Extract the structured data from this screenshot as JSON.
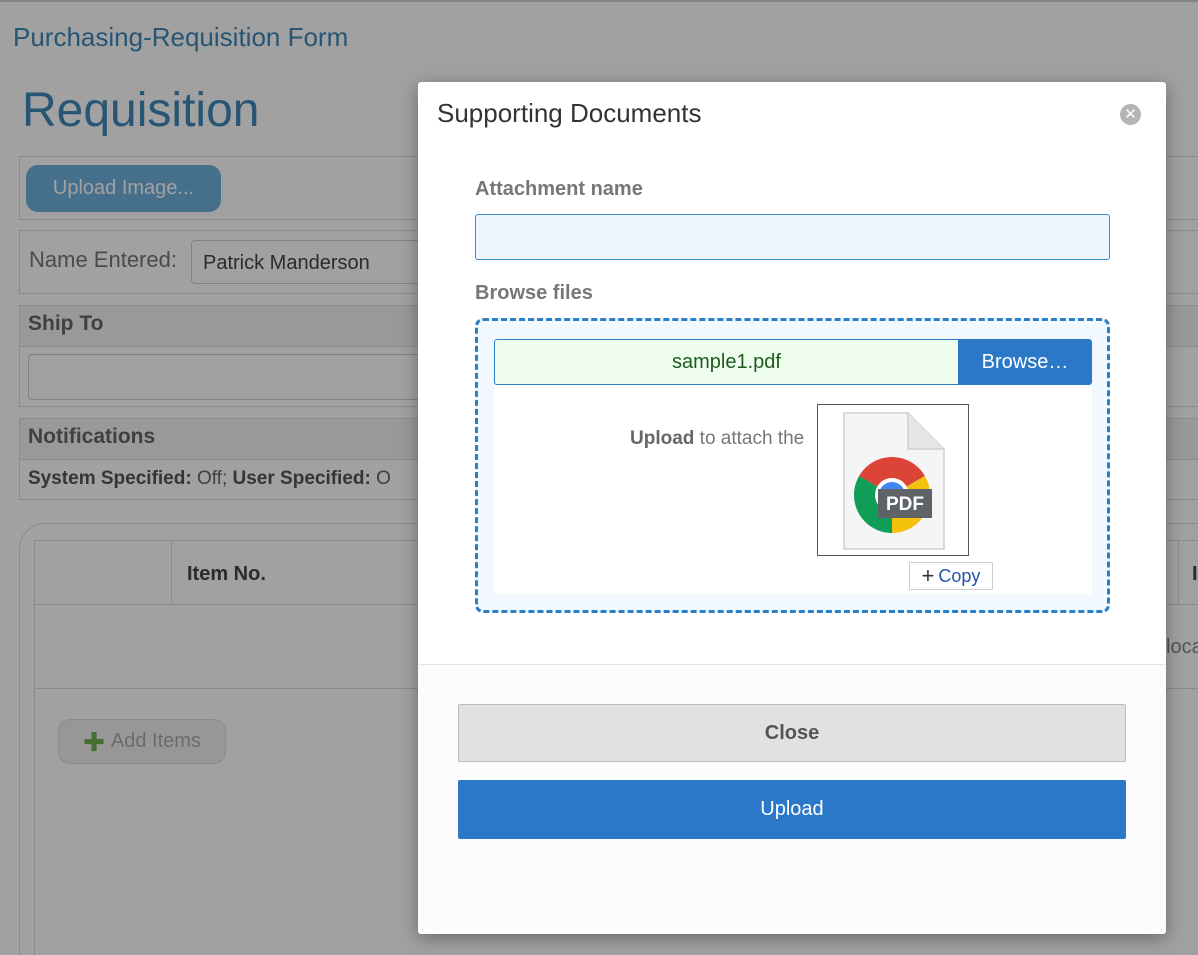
{
  "background": {
    "app_title": "Purchasing-Requisition Form",
    "page_heading": "Requisition",
    "upload_image_label": "Upload Image...",
    "name_entered_label": "Name Entered:",
    "name_entered_value": "Patrick Manderson",
    "ship_to_title": "Ship To",
    "notifications_title": "Notifications",
    "notifications_system_label": "System Specified:",
    "notifications_system_value": " Off; ",
    "notifications_user_label": "User Specified:",
    "notifications_user_value": " O",
    "table_header_item_no": "Item No.",
    "table_header_right_partial": "I",
    "location_partial": "loca",
    "add_items_label": "Add Items"
  },
  "modal": {
    "title": "Supporting Documents",
    "close_icon": "close-icon",
    "attachment_name_label": "Attachment name",
    "attachment_name_value": "",
    "browse_files_label": "Browse files",
    "selected_file": "sample1.pdf",
    "browse_button_label": "Browse…",
    "drop_message_bold": "Upload",
    "drop_message_rest": " to attach the",
    "drag_preview_badge": "PDF",
    "drag_copy_label": "Copy",
    "close_button_label": "Close",
    "upload_button_label": "Upload"
  },
  "colors": {
    "accent_blue": "#2b77c8",
    "heading_blue": "#3f87b8",
    "file_text_green": "#1c5d1c"
  }
}
